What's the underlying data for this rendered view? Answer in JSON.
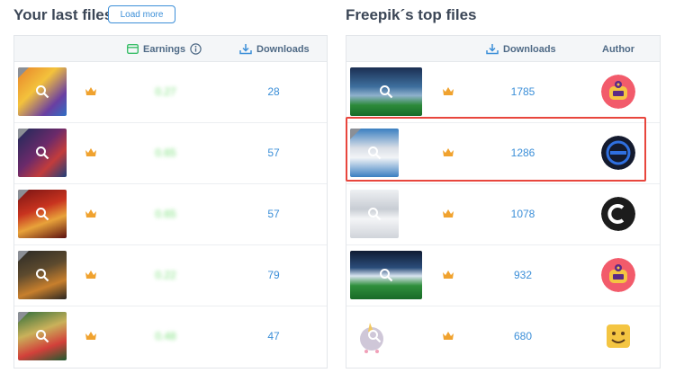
{
  "left": {
    "title": "Your last files",
    "load_more": "Load more",
    "headers": {
      "earnings": "Earnings",
      "downloads": "Downloads"
    },
    "rows": [
      {
        "earnings": "0.27",
        "downloads": "28"
      },
      {
        "earnings": "0.65",
        "downloads": "57"
      },
      {
        "earnings": "0.65",
        "downloads": "57"
      },
      {
        "earnings": "0.22",
        "downloads": "79"
      },
      {
        "earnings": "0.48",
        "downloads": "47"
      }
    ]
  },
  "right": {
    "title": "Freepik´s top files",
    "headers": {
      "downloads": "Downloads",
      "author": "Author"
    },
    "rows": [
      {
        "downloads": "1785"
      },
      {
        "downloads": "1286"
      },
      {
        "downloads": "1078"
      },
      {
        "downloads": "932"
      },
      {
        "downloads": "680"
      }
    ]
  },
  "colors": {
    "accent": "#3c8fd8",
    "premium": "#f0a22e",
    "earnings": "#7de07d",
    "highlight": "#e8463d"
  }
}
